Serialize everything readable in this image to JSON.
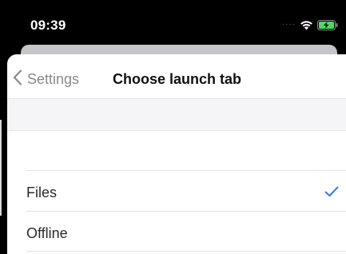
{
  "status_bar": {
    "time": "09:39",
    "signal_icon": "signal-dots-icon",
    "wifi_icon": "wifi-icon",
    "battery_icon": "battery-charging-icon",
    "battery_color": "#4cd964"
  },
  "nav": {
    "back_label": "Settings",
    "back_icon": "chevron-left-icon",
    "title": "Choose launch tab"
  },
  "launch_tab_options": [
    {
      "label": "Files",
      "selected": true
    },
    {
      "label": "Offline",
      "selected": false
    }
  ],
  "accent_color": "#3478f6"
}
